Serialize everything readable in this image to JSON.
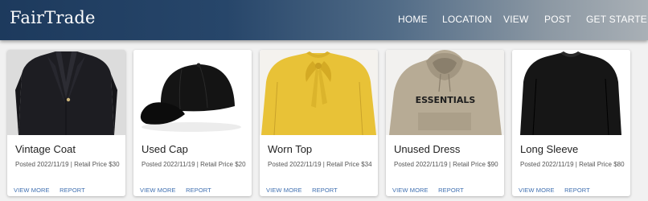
{
  "brand": "FairTrade",
  "nav": [
    "HOME",
    "LOCATION",
    "VIEW",
    "POST",
    "GET STARTED"
  ],
  "listings": [
    {
      "title": "Vintage Coat",
      "posted": "Posted 2022/11/19 | Retail Price $30",
      "image": "black-blazer-photo",
      "view": "VIEW MORE",
      "report": "REPORT"
    },
    {
      "title": "Used Cap",
      "posted": "Posted 2022/11/19 | Retail Price $20",
      "image": "black-cap-photo",
      "view": "VIEW MORE",
      "report": "REPORT"
    },
    {
      "title": "Worn Top",
      "posted": "Posted 2022/11/19 | Retail Price $34",
      "image": "yellow-blouse-photo",
      "view": "VIEW MORE",
      "report": "REPORT"
    },
    {
      "title": "Unused Dress",
      "posted": "Posted 2022/11/19 | Retail Price $90",
      "image": "beige-hoodie-photo",
      "image_text": "ESSENTIALS",
      "view": "VIEW MORE",
      "report": "REPORT"
    },
    {
      "title": "Long Sleeve",
      "posted": "Posted 2022/11/19 | Retail Price $80",
      "image": "black-long-sleeve-photo",
      "view": "VIEW MORE",
      "report": "REPORT"
    }
  ],
  "colors": {
    "nav_start": "#1d3a5d",
    "nav_end": "#a9b0b6",
    "action_link": "#3f6fb0"
  }
}
